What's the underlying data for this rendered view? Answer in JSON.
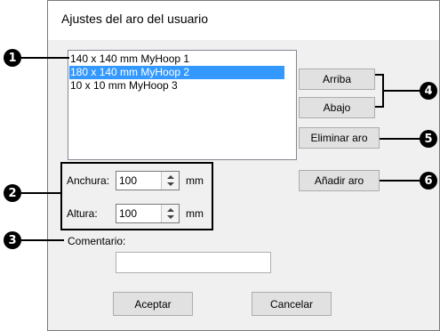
{
  "dialog": {
    "title": "Ajustes del aro del usuario"
  },
  "hoop_list": {
    "items": [
      {
        "label": "140 x 140 mm MyHoop 1",
        "selected": false
      },
      {
        "label": "180 x 140 mm MyHoop 2",
        "selected": true
      },
      {
        "label": "10 x 10 mm MyHoop 3",
        "selected": false
      }
    ]
  },
  "buttons": {
    "up": "Arriba",
    "down": "Abajo",
    "delete": "Eliminar aro",
    "add": "Añadir aro",
    "ok": "Aceptar",
    "cancel": "Cancelar"
  },
  "size": {
    "width_label": "Anchura:",
    "width_value": "100",
    "width_unit": "mm",
    "height_label": "Altura:",
    "height_value": "100",
    "height_unit": "mm"
  },
  "comment": {
    "label": "Comentario:",
    "value": ""
  },
  "callouts": [
    "1",
    "2",
    "3",
    "4",
    "5",
    "6"
  ],
  "colors": {
    "selection": "#3399ff",
    "dialog_bg": "#f0f0f0",
    "button_bg": "#e1e1e1"
  }
}
